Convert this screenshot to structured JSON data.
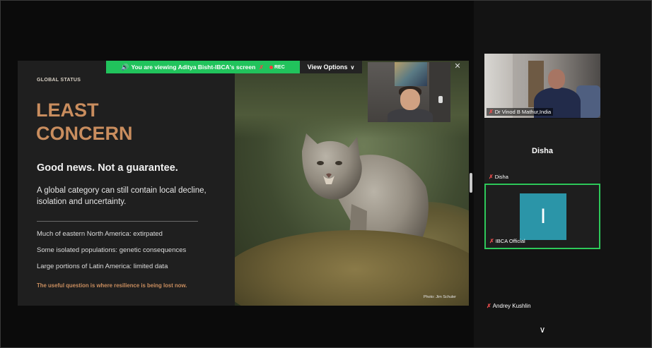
{
  "banner": {
    "viewing_text": "You are viewing Aditya Bisht-IBCA's screen",
    "rec_label": "REC",
    "view_options": "View Options"
  },
  "slide": {
    "tag": "GLOBAL STATUS",
    "status_line1": "LEAST",
    "status_line2": "CONCERN",
    "headline": "Good news. Not a guarantee.",
    "description": "A global category can still contain local decline, isolation and uncertainty.",
    "bullets": [
      "Much of eastern North America: extirpated",
      "Some isolated populations: genetic consequences",
      "Large portions of Latin America: limited data"
    ],
    "callout": "The useful question is where resilience is being lost now.",
    "photo_credit": "Photo: Jim Schuler"
  },
  "participants": [
    {
      "name": "Dr Vinod B Mathur,India"
    },
    {
      "name": "Disha",
      "display": "Disha"
    },
    {
      "name": "IBCA Official",
      "initial": "I"
    },
    {
      "name": "Andrey Kushlin"
    }
  ],
  "colors": {
    "accent": "#c98d5e",
    "banner": "#21c35c",
    "active_border": "#2ec95a",
    "avatar": "#2b95a8",
    "muted": "#e84d4d"
  },
  "icons": {
    "speaker": "speaker-icon",
    "muted_mic": "muted-mic-icon",
    "close": "close-icon",
    "chevron": "chevron-down-icon"
  }
}
